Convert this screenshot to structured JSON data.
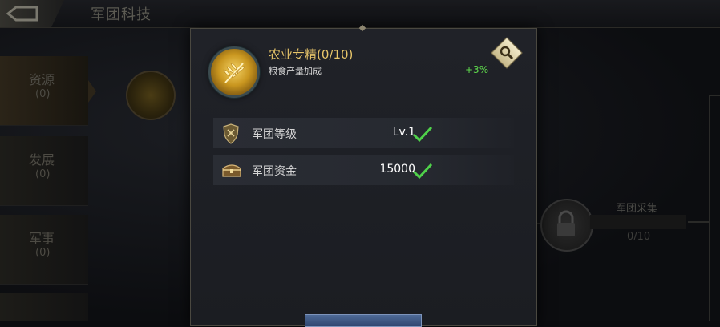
{
  "header": {
    "title": "军团科技"
  },
  "sidebar": {
    "tabs": [
      {
        "name": "资源",
        "count": "(0)"
      },
      {
        "name": "发展",
        "count": "(0)"
      },
      {
        "name": "军事",
        "count": "(0)"
      }
    ]
  },
  "tree": {
    "locked_node": {
      "name": "军团采集",
      "progress": "0/10"
    }
  },
  "popup": {
    "skill_name": "农业专精(0/10)",
    "skill_desc": "粮食产量加成",
    "bonus": "+3%",
    "requirements": [
      {
        "label": "军团等级",
        "value": "Lv.1",
        "icon": "shield-icon",
        "met": true
      },
      {
        "label": "军团资金",
        "value": "15000",
        "icon": "treasure-chest-icon",
        "met": true
      }
    ]
  },
  "colors": {
    "skill_title": "#e8c66a",
    "bonus": "#5ed84c",
    "check": "#4fd14a"
  }
}
